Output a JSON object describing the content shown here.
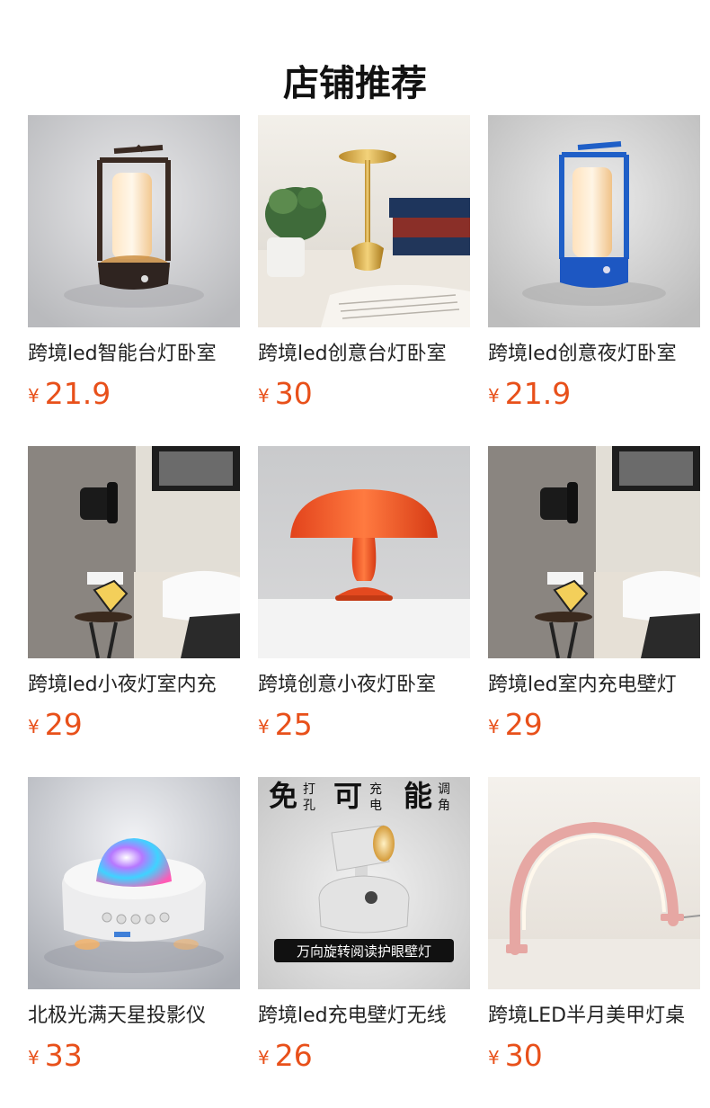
{
  "page": {
    "title": "店铺推荐"
  },
  "products": [
    {
      "name": "跨境led智能台灯卧室",
      "currency": "¥",
      "price": "21.9",
      "image": "brown-lantern-lamp"
    },
    {
      "name": "跨境led创意台灯卧室",
      "currency": "¥",
      "price": "30",
      "image": "gold-mushroom-lamp"
    },
    {
      "name": "跨境led创意夜灯卧室",
      "currency": "¥",
      "price": "21.9",
      "image": "blue-lantern-lamp"
    },
    {
      "name": "跨境led小夜灯室内充",
      "currency": "¥",
      "price": "29",
      "image": "wall-lamp-bedroom"
    },
    {
      "name": "跨境创意小夜灯卧室",
      "currency": "¥",
      "price": "25",
      "image": "orange-mushroom-lamp"
    },
    {
      "name": "跨境led室内充电壁灯",
      "currency": "¥",
      "price": "29",
      "image": "wall-lamp-bedroom"
    },
    {
      "name": "北极光满天星投影仪",
      "currency": "¥",
      "price": "33",
      "image": "star-projector"
    },
    {
      "name": "跨境led充电壁灯无线",
      "currency": "¥",
      "price": "26",
      "image": "reading-wall-lamp"
    },
    {
      "name": "跨境LED半月美甲灯桌",
      "currency": "¥",
      "price": "30",
      "image": "half-moon-lamp"
    }
  ],
  "promo": {
    "big1": "免",
    "small1a": "打",
    "small1b": "孔",
    "big2": "可",
    "small2a": "充",
    "small2b": "电",
    "big3": "能",
    "small3a": "调",
    "small3b": "角",
    "caption": "万向旋转阅读护眼壁灯"
  },
  "colors": {
    "price": "#e8501a"
  }
}
